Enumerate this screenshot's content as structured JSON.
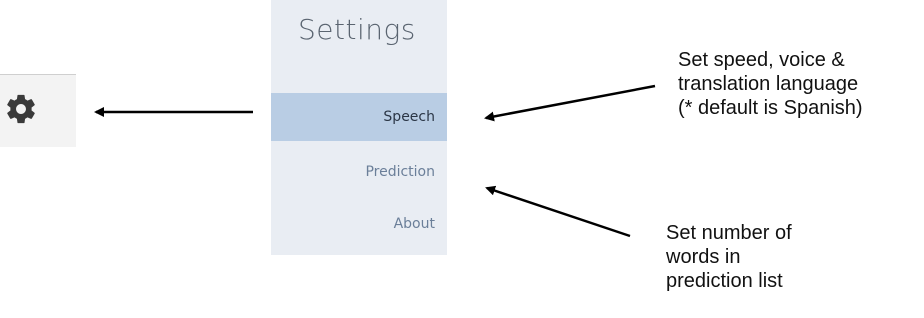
{
  "gear": {
    "icon": "gear-icon"
  },
  "settings": {
    "title": "Settings",
    "items": [
      {
        "label": "Speech",
        "selected": true
      },
      {
        "label": "Prediction",
        "selected": false
      },
      {
        "label": "About",
        "selected": false
      }
    ]
  },
  "annotations": {
    "speech_note": [
      "Set speed, voice &",
      "translation language",
      "(* default is Spanish)"
    ],
    "prediction_note": [
      "Set number of",
      "words in",
      "prediction list"
    ]
  },
  "colors": {
    "panel_bg": "#e9edf3",
    "selected_bg": "#b9cde4",
    "link_text": "#6b7f99"
  }
}
